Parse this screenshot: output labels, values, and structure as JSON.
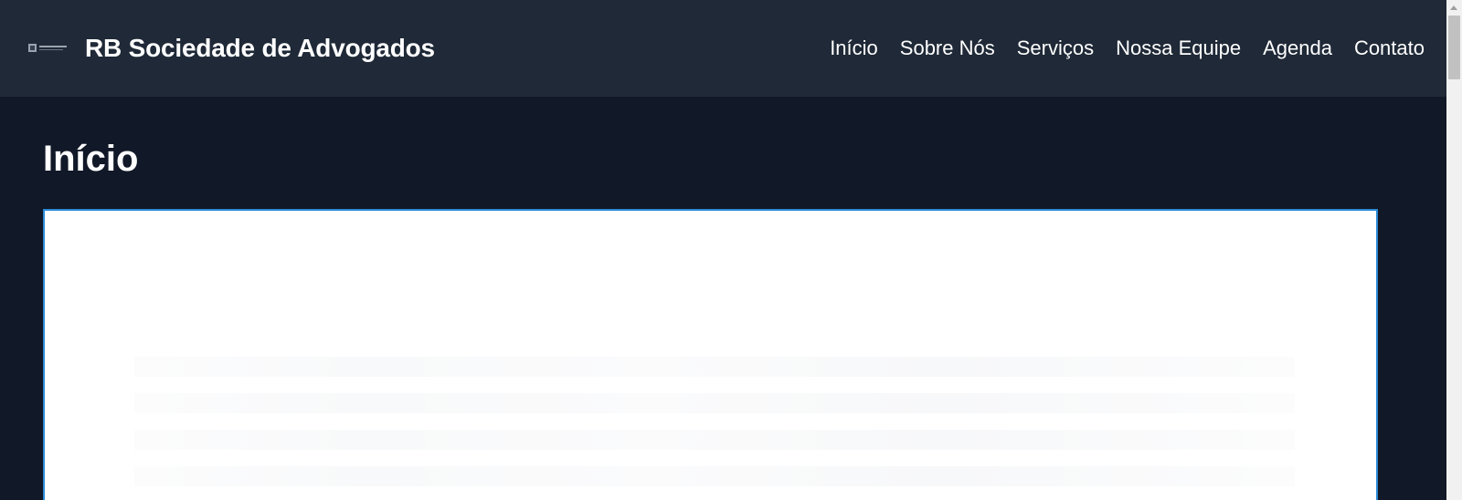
{
  "header": {
    "logo_icon": "firm-logo-icon",
    "brand_title": "RB Sociedade de Advogados",
    "nav": [
      {
        "label": "Início"
      },
      {
        "label": "Sobre Nós"
      },
      {
        "label": "Serviços"
      },
      {
        "label": "Nossa Equipe"
      },
      {
        "label": "Agenda"
      },
      {
        "label": "Contato"
      }
    ]
  },
  "main": {
    "page_title": "Início"
  },
  "colors": {
    "header_bg": "#1f2937",
    "page_bg": "#111827",
    "frame_border": "#2a8ad8",
    "text": "#ffffff"
  }
}
